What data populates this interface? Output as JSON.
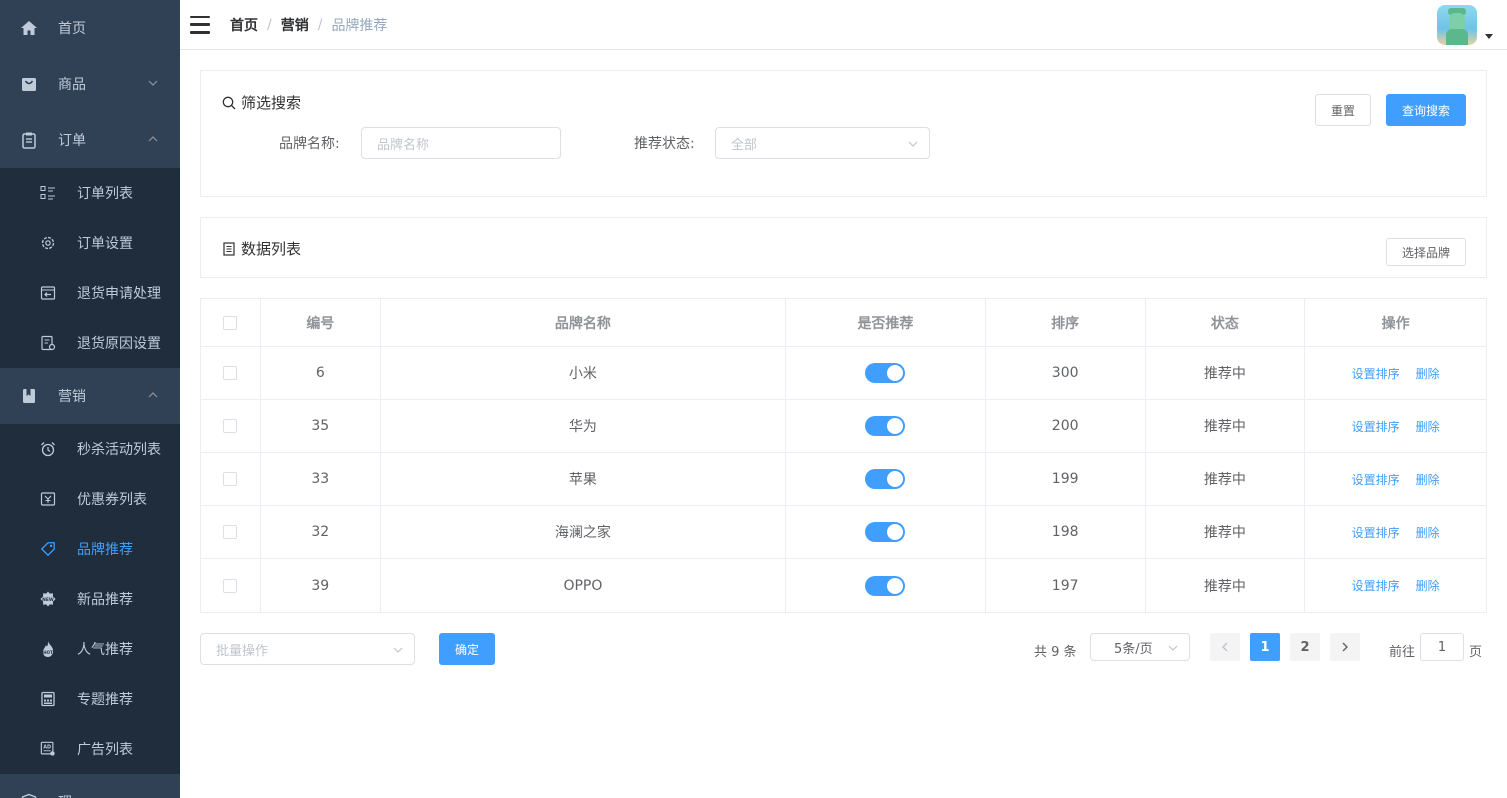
{
  "sidebar": {
    "items": [
      {
        "label": "首页",
        "icon": "home-icon"
      },
      {
        "label": "商品",
        "icon": "shopping-bag-icon"
      },
      {
        "label": "订单",
        "icon": "clipboard-icon"
      },
      {
        "label": "营销",
        "icon": "bookmark-icon"
      },
      {
        "label": "理"
      }
    ],
    "order_sub": [
      {
        "label": "订单列表",
        "icon": "list-icon"
      },
      {
        "label": "订单设置",
        "icon": "gear-icon"
      },
      {
        "label": "退货申请处理",
        "icon": "return-icon"
      },
      {
        "label": "退货原因设置",
        "icon": "document-gear-icon"
      }
    ],
    "marketing_sub": [
      {
        "label": "秒杀活动列表",
        "icon": "alarm-clock-icon"
      },
      {
        "label": "优惠券列表",
        "icon": "coupon-icon"
      },
      {
        "label": "品牌推荐",
        "icon": "tag-icon"
      },
      {
        "label": "新品推荐",
        "icon": "new-badge-icon"
      },
      {
        "label": "人气推荐",
        "icon": "hot-flame-icon"
      },
      {
        "label": "专题推荐",
        "icon": "calculator-icon"
      },
      {
        "label": "广告列表",
        "icon": "ad-icon"
      }
    ]
  },
  "breadcrumb": [
    "首页",
    "营销",
    "品牌推荐"
  ],
  "filter": {
    "title": "筛选搜索",
    "reset_label": "重置",
    "search_label": "查询搜索",
    "brand_name_label": "品牌名称:",
    "brand_name_placeholder": "品牌名称",
    "status_label": "推荐状态:",
    "status_value": "全部"
  },
  "list": {
    "title": "数据列表",
    "select_brand_label": "选择品牌"
  },
  "table": {
    "headers": [
      "编号",
      "品牌名称",
      "是否推荐",
      "排序",
      "状态",
      "操作"
    ],
    "rows": [
      {
        "id": "6",
        "name": "小米",
        "recommended": true,
        "sort": "300",
        "status": "推荐中"
      },
      {
        "id": "35",
        "name": "华为",
        "recommended": true,
        "sort": "200",
        "status": "推荐中"
      },
      {
        "id": "33",
        "name": "苹果",
        "recommended": true,
        "sort": "199",
        "status": "推荐中"
      },
      {
        "id": "32",
        "name": "海澜之家",
        "recommended": true,
        "sort": "198",
        "status": "推荐中"
      },
      {
        "id": "39",
        "name": "OPPO",
        "recommended": true,
        "sort": "197",
        "status": "推荐中"
      }
    ],
    "action_sort": "设置排序",
    "action_delete": "删除"
  },
  "footer": {
    "batch_placeholder": "批量操作",
    "confirm_label": "确定",
    "total": "共 9 条",
    "page_size": "5条/页",
    "pages": [
      "1",
      "2"
    ],
    "current_page": 1,
    "goto_prefix": "前往",
    "goto_value": "1",
    "goto_suffix": "页"
  },
  "colors": {
    "sidebar_bg": "#304156",
    "submenu_bg": "#1f2d3d",
    "primary": "#409eff"
  }
}
